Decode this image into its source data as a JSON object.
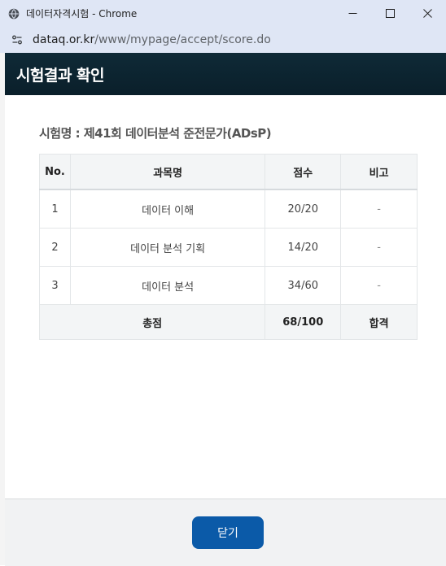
{
  "window": {
    "title": "데이터자격시험 - Chrome",
    "url_host": "dataq.or.kr",
    "url_path": "/www/mypage/accept/score.do"
  },
  "modal": {
    "title": "시험결과 확인",
    "exam_name": "시험명 : 제41회 데이터분석 준전문가(ADsP)",
    "table": {
      "headers": [
        "No.",
        "과목명",
        "점수",
        "비고"
      ],
      "rows": [
        {
          "no": "1",
          "subject": "데이터 이해",
          "score": "20/20",
          "note": "-"
        },
        {
          "no": "2",
          "subject": "데이터 분석 기획",
          "score": "14/20",
          "note": "-"
        },
        {
          "no": "3",
          "subject": "데이터 분석",
          "score": "34/60",
          "note": "-"
        }
      ],
      "total_label": "총점",
      "total_score": "68/100",
      "result": "합격"
    },
    "close_label": "닫기"
  }
}
